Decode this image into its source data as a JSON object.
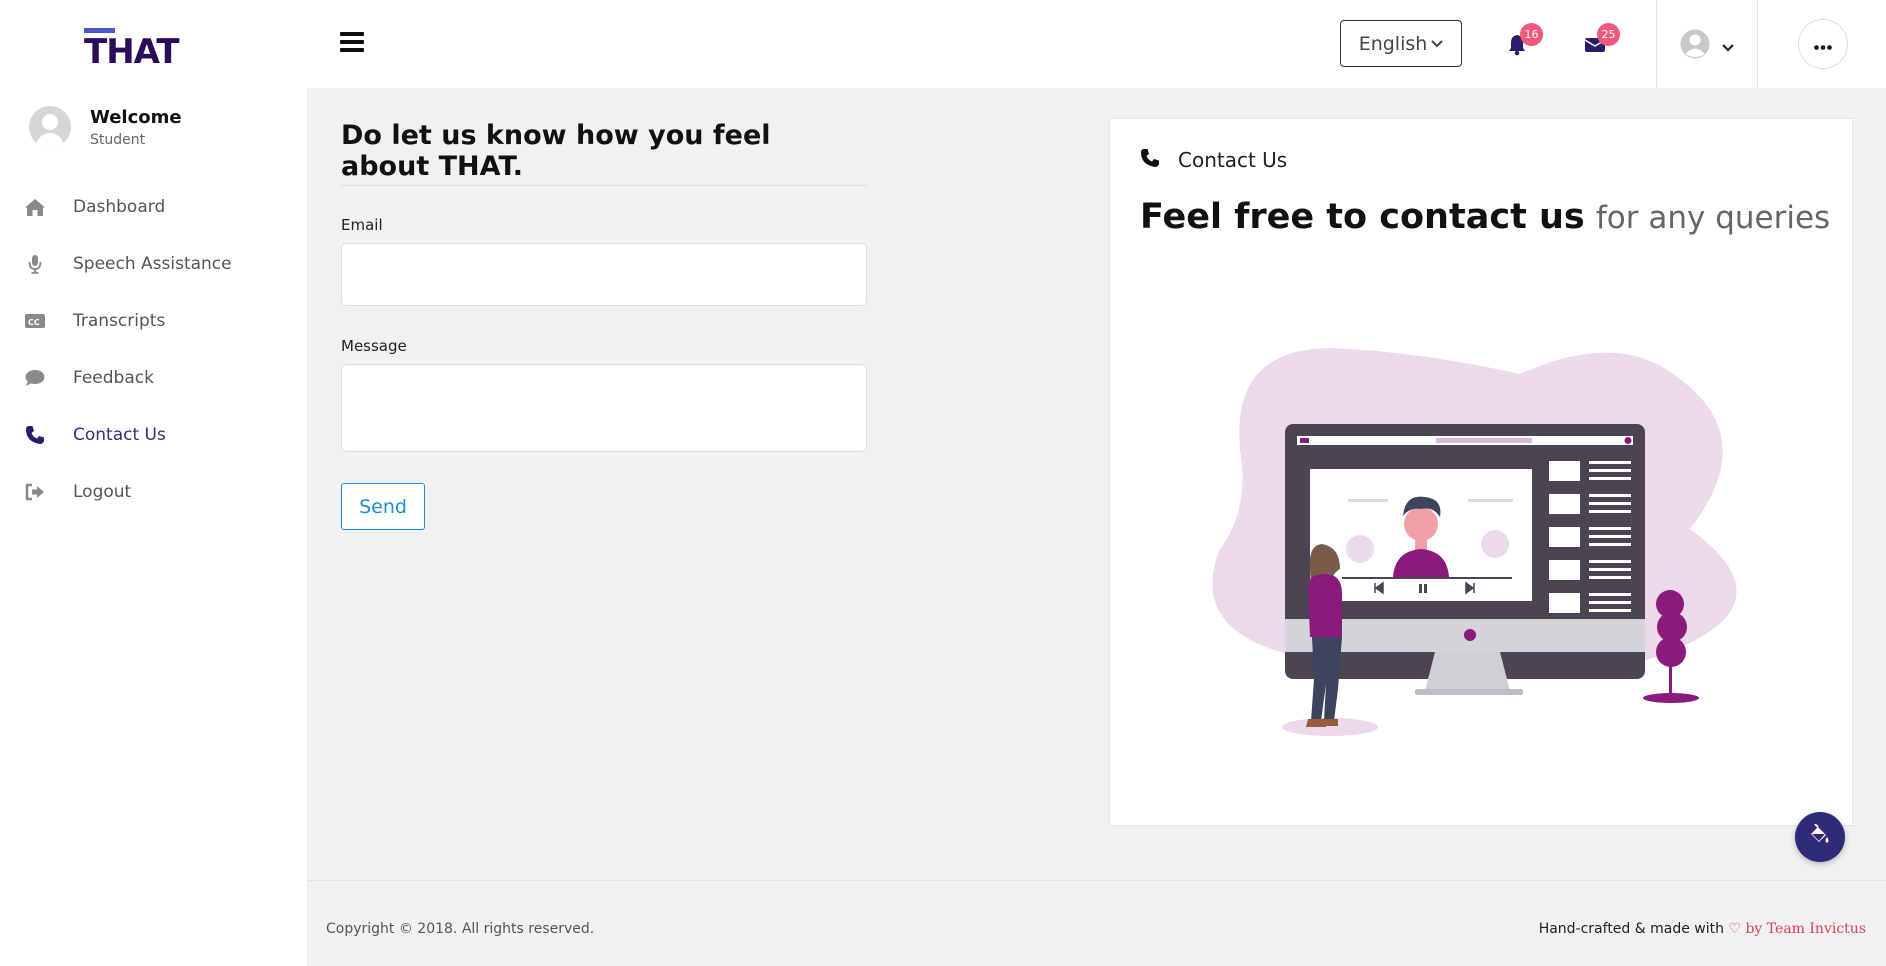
{
  "app": {
    "logo": "THAT"
  },
  "profile": {
    "welcome": "Welcome",
    "role": "Student"
  },
  "sidebar": {
    "items": [
      {
        "label": "Dashboard",
        "icon": "home-icon"
      },
      {
        "label": "Speech Assistance",
        "icon": "microphone-icon"
      },
      {
        "label": "Transcripts",
        "icon": "closed-caption-icon"
      },
      {
        "label": "Feedback",
        "icon": "comment-icon"
      },
      {
        "label": "Contact Us",
        "icon": "phone-icon",
        "active": true
      },
      {
        "label": "Logout",
        "icon": "sign-out-icon"
      }
    ]
  },
  "header": {
    "language": "English",
    "notifications_count": "16",
    "messages_count": "25"
  },
  "form": {
    "title": "Do let us know how you feel about THAT.",
    "email_label": "Email",
    "email_value": "",
    "message_label": "Message",
    "message_value": "",
    "send_label": "Send"
  },
  "contact": {
    "heading": "Contact Us",
    "headline_strong": "Feel free to contact us",
    "headline_light": "for any queries"
  },
  "footer": {
    "copyright": "Copyright © 2018. All rights reserved.",
    "credit_prefix": "Hand-crafted & made with",
    "credit_team": "by Team Invictus"
  },
  "colors": {
    "brand": "#2a0c5a",
    "accent": "#1f8dd6",
    "badge": "#f05a7a",
    "illustration_purple": "#8a1a7c"
  }
}
